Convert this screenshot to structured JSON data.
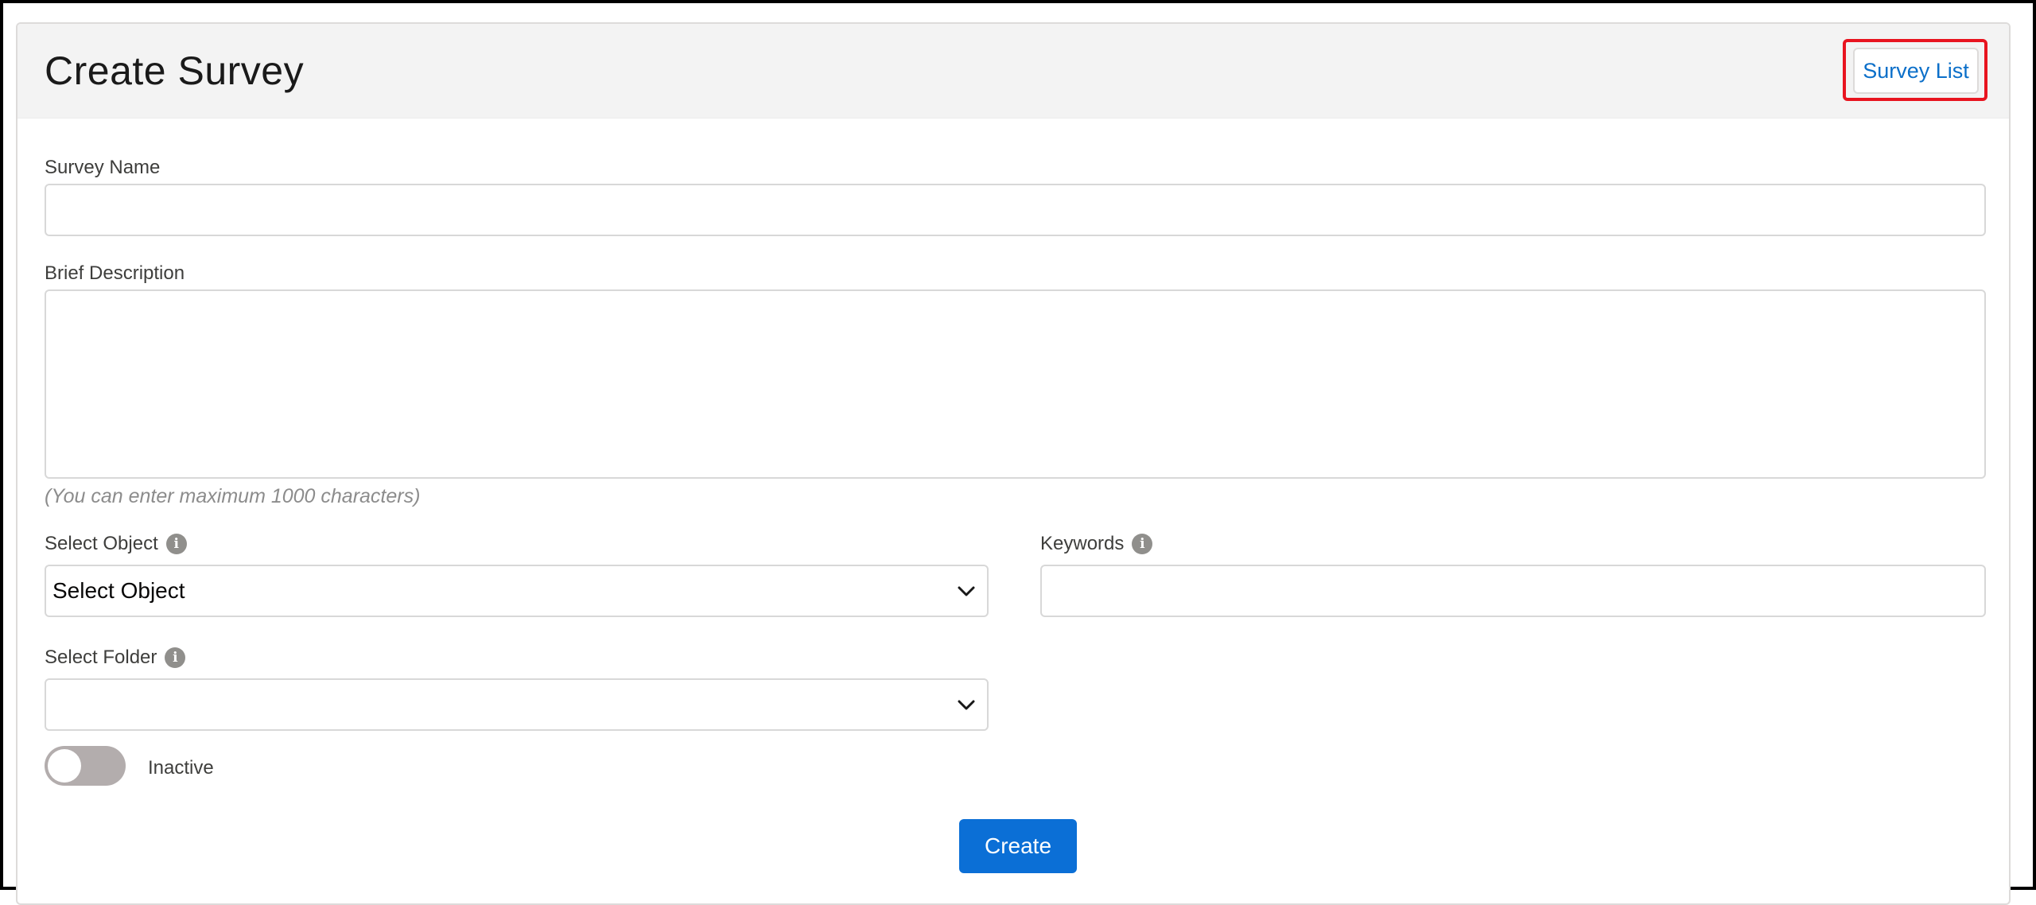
{
  "header": {
    "title": "Create Survey",
    "survey_list_label": "Survey List"
  },
  "form": {
    "survey_name": {
      "label": "Survey Name",
      "value": "",
      "placeholder": ""
    },
    "brief_description": {
      "label": "Brief Description",
      "value": "",
      "placeholder": "",
      "helper": "(You can enter maximum 1000 characters)"
    },
    "select_object": {
      "label": "Select Object",
      "info_icon": "info-icon",
      "selected": "Select Object"
    },
    "keywords": {
      "label": "Keywords",
      "info_icon": "info-icon",
      "value": "",
      "placeholder": ""
    },
    "select_folder": {
      "label": "Select Folder",
      "info_icon": "info-icon",
      "selected": ""
    },
    "active_toggle": {
      "label": "Inactive",
      "on": false
    },
    "create_label": "Create"
  },
  "colors": {
    "accent": "#0b6fd6",
    "link": "#0b6fc9",
    "highlight": "#e8141f",
    "toggle_off": "#b3adad"
  }
}
